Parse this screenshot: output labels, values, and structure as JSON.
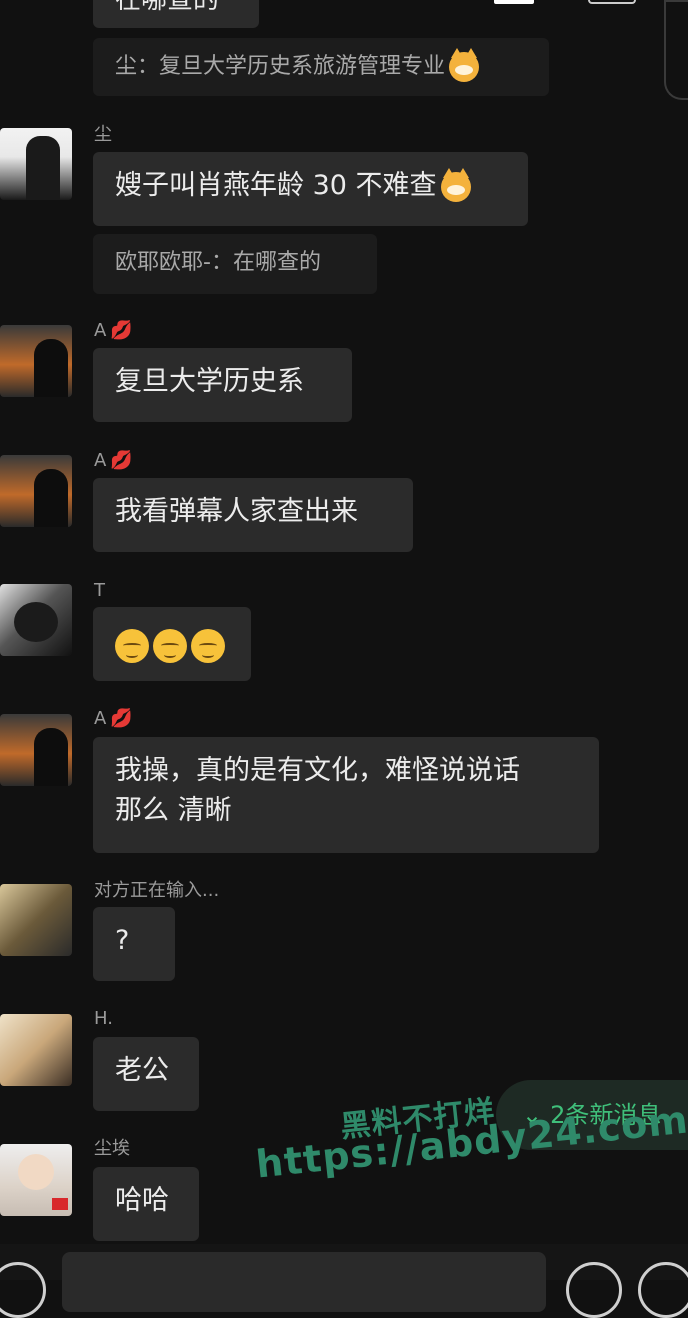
{
  "top_partial": {
    "bubble_text": "在哪查的"
  },
  "messages": [
    {
      "id": "q1",
      "type": "quote",
      "text": "尘：复旦大学历史系旅游管理专业"
    },
    {
      "id": "m1",
      "sender": "尘",
      "text": "嫂子叫肖燕年龄 30 不难查"
    },
    {
      "id": "q2",
      "type": "quote",
      "text": "欧耶欧耶-：在哪查的"
    },
    {
      "id": "m2",
      "sender": "A",
      "text": "复旦大学历史系"
    },
    {
      "id": "m3",
      "sender": "A",
      "text": "我看弹幕人家查出来"
    },
    {
      "id": "m4",
      "sender": "T",
      "text": ""
    },
    {
      "id": "m5",
      "sender": "A",
      "line1": "我操，真的是有文化，难怪说说话",
      "line2": "那么 清晰"
    },
    {
      "id": "m6",
      "sender": "对方正在输入...",
      "text": "?"
    },
    {
      "id": "m7",
      "sender": "H.",
      "text": "老公"
    },
    {
      "id": "m8",
      "sender": "尘埃",
      "text": "哈哈"
    }
  ],
  "new_messages_label": "2条新消息",
  "watermark": {
    "line1": "黑料不打烊",
    "line2": "https://abdy24.com"
  },
  "icons": {
    "lips": "lips-emoji",
    "cat": "cat-emoji",
    "faces": [
      "pensive-face",
      "unamused-face",
      "dizzy-face"
    ]
  }
}
